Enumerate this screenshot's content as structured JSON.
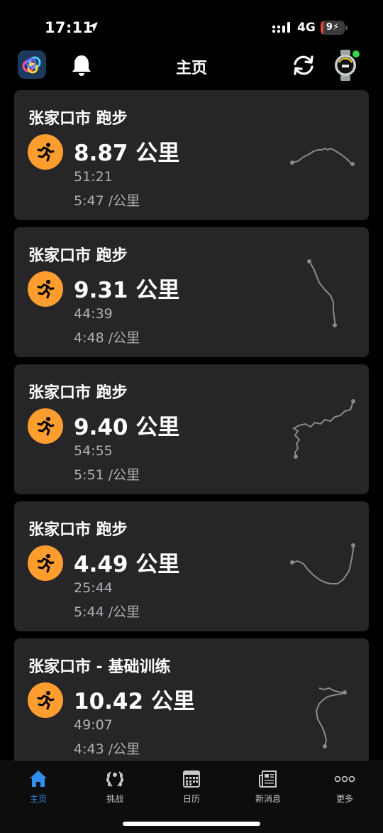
{
  "status_bar": {
    "time": "17:11",
    "network": "4G",
    "battery_percent": 9,
    "battery_text": "9"
  },
  "header": {
    "title": "主页",
    "icons": [
      "app-logo-icon",
      "bell-icon",
      "sync-icon",
      "watch-icon"
    ],
    "watch_connected_color": "#32d74b"
  },
  "accent_color": "#ff9d2e",
  "activities": [
    {
      "title": "张家口市 跑步",
      "distance": "8.87 公里",
      "duration": "51:21",
      "pace": "5:47 /公里",
      "icon": "running-icon"
    },
    {
      "title": "张家口市 跑步",
      "distance": "9.31 公里",
      "duration": "44:39",
      "pace": "4:48 /公里",
      "icon": "running-icon"
    },
    {
      "title": "张家口市 跑步",
      "distance": "9.40 公里",
      "duration": "54:55",
      "pace": "5:51 /公里",
      "icon": "running-icon"
    },
    {
      "title": "张家口市 跑步",
      "distance": "4.49 公里",
      "duration": "25:44",
      "pace": "5:44 /公里",
      "icon": "running-icon"
    },
    {
      "title": "张家口市 - 基础训练",
      "distance": "10.42 公里",
      "duration": "49:07",
      "pace": "4:43 /公里",
      "icon": "running-icon"
    }
  ],
  "tabs": [
    {
      "label": "主页",
      "icon": "home-icon",
      "active": true
    },
    {
      "label": "挑战",
      "icon": "laurel-icon",
      "active": false
    },
    {
      "label": "日历",
      "icon": "calendar-icon",
      "active": false
    },
    {
      "label": "新消息",
      "icon": "newspaper-icon",
      "active": false
    },
    {
      "label": "更多",
      "icon": "more-icon",
      "active": false
    }
  ],
  "tab_active_color": "#2f8ff0"
}
